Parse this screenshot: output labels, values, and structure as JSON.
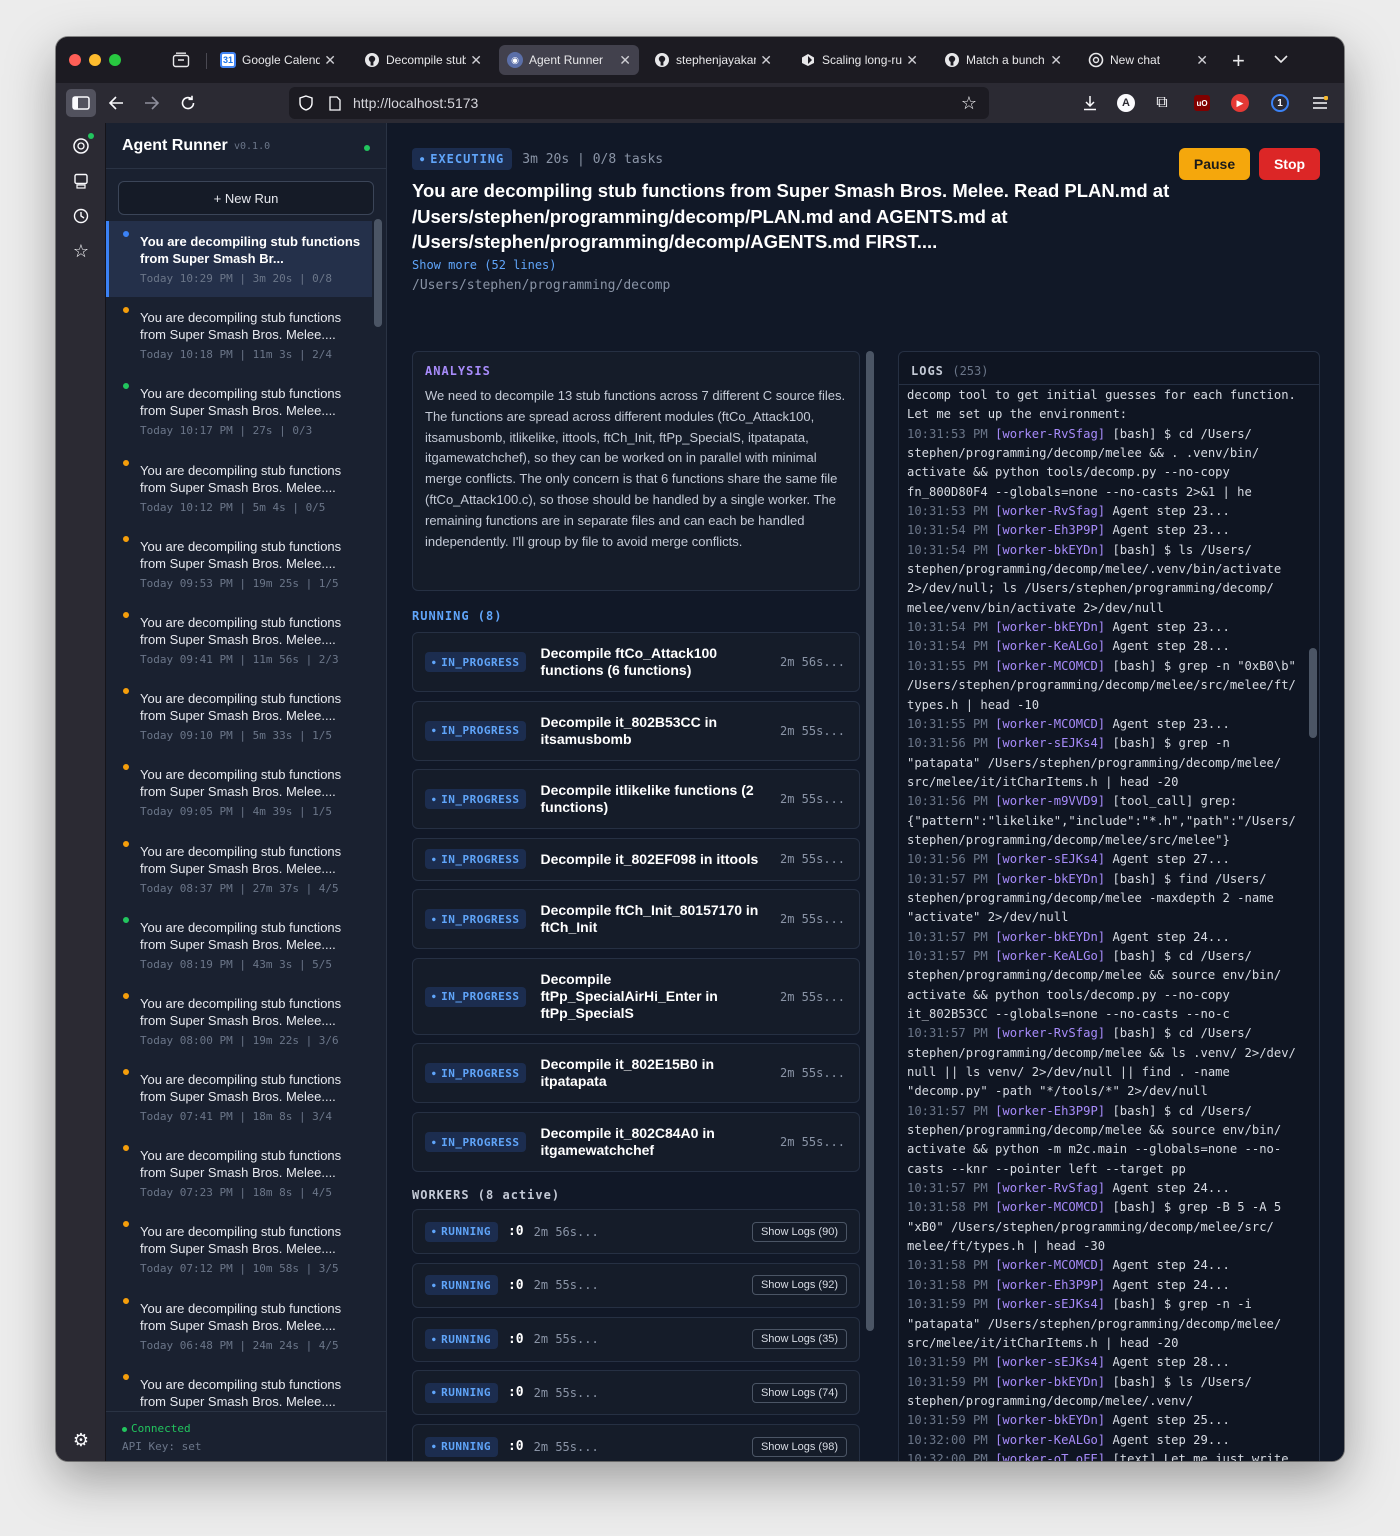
{
  "browser": {
    "tabs": [
      {
        "label": "Google Calendar",
        "icon": "calendar-icon"
      },
      {
        "label": "Decompile stub f",
        "icon": "github-icon"
      },
      {
        "label": "Agent Runner",
        "icon": "agent-icon"
      },
      {
        "label": "stephenjayakar/a",
        "icon": "github-icon"
      },
      {
        "label": "Scaling long-run",
        "icon": "cursor-icon"
      },
      {
        "label": "Match a bunch o",
        "icon": "github-icon"
      },
      {
        "label": "New chat",
        "icon": "openai-icon"
      }
    ],
    "url": "http://localhost:5173"
  },
  "sidebar": {
    "app_name": "Agent Runner",
    "version": "v0.1.0",
    "new_run_label": "+ New Run",
    "runs": [
      {
        "title": "You are decompiling stub functions from Super Smash Br...",
        "meta": "Today 10:29 PM | 3m 20s | 0/8",
        "status_color": "#3b82f6",
        "active": true
      },
      {
        "title": "You are decompiling stub functions from Super Smash Bros. Melee....",
        "meta": "Today 10:18 PM | 11m 3s | 2/4",
        "status_color": "#f59e0b"
      },
      {
        "title": "You are decompiling stub functions from Super Smash Bros. Melee....",
        "meta": "Today 10:17 PM | 27s | 0/3",
        "status_color": "#22c55e"
      },
      {
        "title": "You are decompiling stub functions from Super Smash Bros. Melee....",
        "meta": "Today 10:12 PM | 5m 4s | 0/5",
        "status_color": "#f59e0b"
      },
      {
        "title": "You are decompiling stub functions from Super Smash Bros. Melee....",
        "meta": "Today 09:53 PM | 19m 25s | 1/5",
        "status_color": "#f59e0b"
      },
      {
        "title": "You are decompiling stub functions from Super Smash Bros. Melee....",
        "meta": "Today 09:41 PM | 11m 56s | 2/3",
        "status_color": "#f59e0b"
      },
      {
        "title": "You are decompiling stub functions from Super Smash Bros. Melee....",
        "meta": "Today 09:10 PM | 5m 33s | 1/5",
        "status_color": "#f59e0b"
      },
      {
        "title": "You are decompiling stub functions from Super Smash Bros. Melee....",
        "meta": "Today 09:05 PM | 4m 39s | 1/5",
        "status_color": "#f59e0b"
      },
      {
        "title": "You are decompiling stub functions from Super Smash Bros. Melee....",
        "meta": "Today 08:37 PM | 27m 37s | 4/5",
        "status_color": "#f59e0b"
      },
      {
        "title": "You are decompiling stub functions from Super Smash Bros. Melee....",
        "meta": "Today 08:19 PM | 43m 3s | 5/5",
        "status_color": "#22c55e"
      },
      {
        "title": "You are decompiling stub functions from Super Smash Bros. Melee....",
        "meta": "Today 08:00 PM | 19m 22s | 3/6",
        "status_color": "#f59e0b"
      },
      {
        "title": "You are decompiling stub functions from Super Smash Bros. Melee....",
        "meta": "Today 07:41 PM | 18m 8s | 3/4",
        "status_color": "#f59e0b"
      },
      {
        "title": "You are decompiling stub functions from Super Smash Bros. Melee....",
        "meta": "Today 07:23 PM | 18m 8s | 4/5",
        "status_color": "#f59e0b"
      },
      {
        "title": "You are decompiling stub functions from Super Smash Bros. Melee....",
        "meta": "Today 07:12 PM | 10m 58s | 3/5",
        "status_color": "#f59e0b"
      },
      {
        "title": "You are decompiling stub functions from Super Smash Bros. Melee....",
        "meta": "Today 06:48 PM | 24m 24s | 4/5",
        "status_color": "#f59e0b"
      },
      {
        "title": "You are decompiling stub functions from Super Smash Bros. Melee....",
        "meta": "",
        "status_color": "#f59e0b"
      }
    ],
    "connection": "Connected",
    "api_key": "API Key: set"
  },
  "main": {
    "status": "EXECUTING",
    "meta": "3m 20s | 0/8 tasks",
    "pause_label": "Pause",
    "stop_label": "Stop",
    "prompt": "You are decompiling stub functions from Super Smash Bros. Melee. Read PLAN.md at /Users/stephen/programming/decomp/PLAN.md and AGENTS.md at /Users/stephen/programming/decomp/AGENTS.md FIRST....",
    "show_more": "Show more (52 lines)",
    "cwd": "/Users/stephen/programming/decomp",
    "analysis_title": "ANALYSIS",
    "analysis": "We need to decompile 13 stub functions across 7 different C source files. The functions are spread across different modules (ftCo_Attack100, itsamusbomb, itlikelike, ittools, ftCh_Init, ftPp_SpecialS, itpatapata, itgamewatchchef), so they can be worked on in parallel with minimal merge conflicts. The only concern is that 6 functions share the same file (ftCo_Attack100.c), so those should be handled by a single worker. The remaining functions are in separate files and can each be handled independently. I'll group by file to avoid merge conflicts.",
    "running_title": "RUNNING (8)",
    "tasks": [
      {
        "status": "IN_PROGRESS",
        "title": "Decompile ftCo_Attack100 functions (6 functions)",
        "time": "2m 56s..."
      },
      {
        "status": "IN_PROGRESS",
        "title": "Decompile it_802B53CC in itsamusbomb",
        "time": "2m 55s..."
      },
      {
        "status": "IN_PROGRESS",
        "title": "Decompile itlikelike functions (2 functions)",
        "time": "2m 55s..."
      },
      {
        "status": "IN_PROGRESS",
        "title": "Decompile it_802EF098 in ittools",
        "time": "2m 55s..."
      },
      {
        "status": "IN_PROGRESS",
        "title": "Decompile ftCh_Init_80157170 in ftCh_Init",
        "time": "2m 55s..."
      },
      {
        "status": "IN_PROGRESS",
        "title": "Decompile ftPp_SpecialAirHi_Enter in ftPp_SpecialS",
        "time": "2m 55s..."
      },
      {
        "status": "IN_PROGRESS",
        "title": "Decompile it_802E15B0 in itpatapata",
        "time": "2m 55s..."
      },
      {
        "status": "IN_PROGRESS",
        "title": "Decompile it_802C84A0 in itgamewatchchef",
        "time": "2m 55s..."
      }
    ],
    "workers_title": "WORKERS (8 active)",
    "workers": [
      {
        "status": "RUNNING",
        "id": ":0",
        "time": "2m 56s...",
        "logs": "Show Logs (90)"
      },
      {
        "status": "RUNNING",
        "id": ":0",
        "time": "2m 55s...",
        "logs": "Show Logs (92)"
      },
      {
        "status": "RUNNING",
        "id": ":0",
        "time": "2m 55s...",
        "logs": "Show Logs (35)"
      },
      {
        "status": "RUNNING",
        "id": ":0",
        "time": "2m 55s...",
        "logs": "Show Logs (74)"
      },
      {
        "status": "RUNNING",
        "id": ":0",
        "time": "2m 55s...",
        "logs": "Show Logs (98)"
      }
    ],
    "logs_title": "LOGS",
    "logs_count": "(253)",
    "log_lines": [
      {
        "text": "decomp tool to get initial guesses for each function."
      },
      {
        "text": "Let me set up the environment:"
      },
      {
        "time": "10:31:53 PM",
        "worker": "[worker-RvSfag]",
        "text": " [bash] $ cd /Users/"
      },
      {
        "text": "stephen/programming/decomp/melee && . .venv/bin/"
      },
      {
        "text": "activate && python tools/decomp.py --no-copy"
      },
      {
        "text": "fn_800D80F4 --globals=none --no-casts 2>&1 | he"
      },
      {
        "time": "10:31:53 PM",
        "worker": "[worker-RvSfag]",
        "text": " Agent step 23..."
      },
      {
        "time": "10:31:54 PM",
        "worker": "[worker-Eh3P9P]",
        "text": " Agent step 23..."
      },
      {
        "time": "10:31:54 PM",
        "worker": "[worker-bkEYDn]",
        "text": " [bash] $ ls /Users/"
      },
      {
        "text": "stephen/programming/decomp/melee/.venv/bin/activate"
      },
      {
        "text": "2>/dev/null; ls /Users/stephen/programming/decomp/"
      },
      {
        "text": "melee/venv/bin/activate 2>/dev/null"
      },
      {
        "time": "10:31:54 PM",
        "worker": "[worker-bkEYDn]",
        "text": " Agent step 23..."
      },
      {
        "time": "10:31:54 PM",
        "worker": "[worker-KeALGo]",
        "text": " Agent step 28..."
      },
      {
        "time": "10:31:55 PM",
        "worker": "[worker-MCOMCD]",
        "text": " [bash] $ grep -n \"0xB0\\b\""
      },
      {
        "text": "/Users/stephen/programming/decomp/melee/src/melee/ft/"
      },
      {
        "text": "types.h | head -10"
      },
      {
        "time": "10:31:55 PM",
        "worker": "[worker-MCOMCD]",
        "text": " Agent step 23..."
      },
      {
        "time": "10:31:56 PM",
        "worker": "[worker-sEJKs4]",
        "text": " [bash] $ grep -n"
      },
      {
        "text": "\"patapata\" /Users/stephen/programming/decomp/melee/"
      },
      {
        "text": "src/melee/it/itCharItems.h | head -20"
      },
      {
        "time": "10:31:56 PM",
        "worker": "[worker-m9VVD9]",
        "text": " [tool_call] grep:"
      },
      {
        "text": "{\"pattern\":\"likelike\",\"include\":\"*.h\",\"path\":\"/Users/"
      },
      {
        "text": "stephen/programming/decomp/melee/src/melee\"}"
      },
      {
        "time": "10:31:56 PM",
        "worker": "[worker-sEJKs4]",
        "text": " Agent step 27..."
      },
      {
        "time": "10:31:57 PM",
        "worker": "[worker-bkEYDn]",
        "text": " [bash] $ find /Users/"
      },
      {
        "text": "stephen/programming/decomp/melee -maxdepth 2 -name"
      },
      {
        "text": "\"activate\" 2>/dev/null"
      },
      {
        "time": "10:31:57 PM",
        "worker": "[worker-bkEYDn]",
        "text": " Agent step 24..."
      },
      {
        "time": "10:31:57 PM",
        "worker": "[worker-KeALGo]",
        "text": " [bash] $ cd /Users/"
      },
      {
        "text": "stephen/programming/decomp/melee && source env/bin/"
      },
      {
        "text": "activate && python tools/decomp.py --no-copy"
      },
      {
        "text": "it_802B53CC --globals=none --no-casts --no-c"
      },
      {
        "time": "10:31:57 PM",
        "worker": "[worker-RvSfag]",
        "text": " [bash] $ cd /Users/"
      },
      {
        "text": "stephen/programming/decomp/melee && ls .venv/ 2>/dev/"
      },
      {
        "text": "null || ls venv/ 2>/dev/null || find . -name"
      },
      {
        "text": "\"decomp.py\" -path \"*/tools/*\" 2>/dev/null"
      },
      {
        "time": "10:31:57 PM",
        "worker": "[worker-Eh3P9P]",
        "text": " [bash] $ cd /Users/"
      },
      {
        "text": "stephen/programming/decomp/melee && source env/bin/"
      },
      {
        "text": "activate && python -m m2c.main --globals=none --no-"
      },
      {
        "text": "casts --knr --pointer left --target pp"
      },
      {
        "time": "10:31:57 PM",
        "worker": "[worker-RvSfag]",
        "text": " Agent step 24..."
      },
      {
        "time": "10:31:58 PM",
        "worker": "[worker-MCOMCD]",
        "text": " [bash] $ grep -B 5 -A 5"
      },
      {
        "text": "\"xB0\" /Users/stephen/programming/decomp/melee/src/"
      },
      {
        "text": "melee/ft/types.h | head -30"
      },
      {
        "time": "10:31:58 PM",
        "worker": "[worker-MCOMCD]",
        "text": " Agent step 24..."
      },
      {
        "time": "10:31:58 PM",
        "worker": "[worker-Eh3P9P]",
        "text": " Agent step 24..."
      },
      {
        "time": "10:31:59 PM",
        "worker": "[worker-sEJKs4]",
        "text": " [bash] $ grep -n -i"
      },
      {
        "text": "\"patapata\" /Users/stephen/programming/decomp/melee/"
      },
      {
        "text": "src/melee/it/itCharItems.h | head -20"
      },
      {
        "time": "10:31:59 PM",
        "worker": "[worker-sEJKs4]",
        "text": " Agent step 28..."
      },
      {
        "time": "10:31:59 PM",
        "worker": "[worker-bkEYDn]",
        "text": " [bash] $ ls /Users/"
      },
      {
        "text": "stephen/programming/decomp/melee/.venv/"
      },
      {
        "time": "10:31:59 PM",
        "worker": "[worker-bkEYDn]",
        "text": " Agent step 25..."
      },
      {
        "time": "10:32:00 PM",
        "worker": "[worker-KeALGo]",
        "text": " Agent step 29..."
      },
      {
        "time": "10:32:00 PM",
        "worker": "[worker-oT_oFE]",
        "text": " [text] Let me just write"
      },
      {
        "text": "the function based on my analysis of the ASM and the"
      }
    ]
  }
}
